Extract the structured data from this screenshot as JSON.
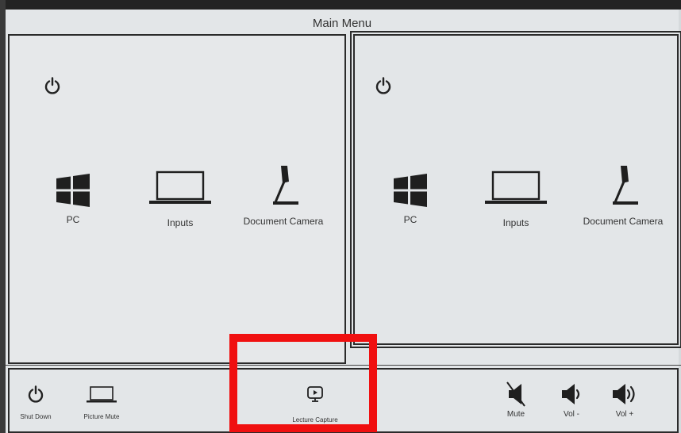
{
  "header": {
    "title": "Main Menu"
  },
  "left_panel": {
    "sources": [
      {
        "icon": "windows-logo-icon",
        "label": "PC"
      },
      {
        "icon": "laptop-icon",
        "label": "Inputs"
      },
      {
        "icon": "document-camera-icon",
        "label": "Document Camera"
      }
    ]
  },
  "right_panel": {
    "sources": [
      {
        "icon": "windows-logo-icon",
        "label": "PC"
      },
      {
        "icon": "laptop-icon",
        "label": "Inputs"
      },
      {
        "icon": "document-camera-icon",
        "label": "Document Camera"
      }
    ]
  },
  "bottom_bar": {
    "shut_down": "Shut Down",
    "picture_mute": "Picture Mute",
    "lecture_capture": "Lecture Capture",
    "mute": "Mute",
    "vol_down": "Vol -",
    "vol_up": "Vol +"
  },
  "colors": {
    "highlight": "#f01010",
    "panel_border": "#2b2b2b",
    "background": "#e3e6e8"
  }
}
